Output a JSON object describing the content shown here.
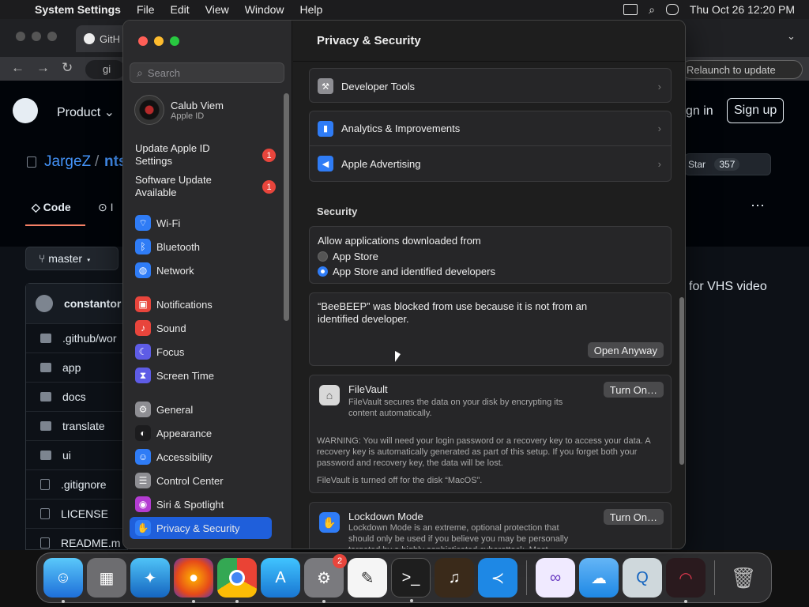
{
  "menubar": {
    "app": "System Settings",
    "items": [
      "File",
      "Edit",
      "View",
      "Window",
      "Help"
    ],
    "clock": "Thu Oct 26  12:20 PM"
  },
  "browser": {
    "tab_title": "GitH",
    "relaunch": "Relaunch to update",
    "url_partial": "gi",
    "gh_product": "Product",
    "gh_signin": "gn in",
    "gh_signup": "Sign up",
    "repo_owner": "JargeZ",
    "repo_sep": "/",
    "repo_name": "nts",
    "star_label": "Star",
    "star_count": "357",
    "tab_code": "Code",
    "tab_issues": "I",
    "branch": "master",
    "committer": "constantor",
    "desc_partial": "for VHS video",
    "files": [
      ".github/wor",
      "app",
      "docs",
      "translate",
      "ui",
      ".gitignore",
      "LICENSE",
      "README.m"
    ]
  },
  "settings": {
    "search_placeholder": "Search",
    "account": {
      "name": "Calub Viem",
      "sub": "Apple ID"
    },
    "updates": [
      {
        "label": "Update Apple ID Settings",
        "badge": "1"
      },
      {
        "label": "Software Update Available",
        "badge": "1"
      }
    ],
    "nav": [
      {
        "label": "Wi-Fi",
        "color": "#2f7cf6",
        "glyph": "⌔"
      },
      {
        "label": "Bluetooth",
        "color": "#2f7cf6",
        "glyph": "ᛒ"
      },
      {
        "label": "Network",
        "color": "#2f7cf6",
        "glyph": "◍"
      },
      {
        "label": "Notifications",
        "color": "#e8453c",
        "glyph": "▣"
      },
      {
        "label": "Sound",
        "color": "#e8453c",
        "glyph": "♪"
      },
      {
        "label": "Focus",
        "color": "#5e5ce6",
        "glyph": "☾"
      },
      {
        "label": "Screen Time",
        "color": "#5e5ce6",
        "glyph": "⧗"
      },
      {
        "label": "General",
        "color": "#8e8e93",
        "glyph": "⚙"
      },
      {
        "label": "Appearance",
        "color": "#1c1c1e",
        "glyph": "◐"
      },
      {
        "label": "Accessibility",
        "color": "#2f7cf6",
        "glyph": "☺"
      },
      {
        "label": "Control Center",
        "color": "#8e8e93",
        "glyph": "☰"
      },
      {
        "label": "Siri & Spotlight",
        "color": "#b43cd2",
        "glyph": "◉"
      },
      {
        "label": "Privacy & Security",
        "color": "#2f7cf6",
        "glyph": "✋"
      }
    ],
    "content_title": "Privacy & Security",
    "rows_top": [
      {
        "label": "Developer Tools"
      },
      {
        "label": "Analytics & Improvements"
      },
      {
        "label": "Apple Advertising"
      }
    ],
    "security_title": "Security",
    "allow_label": "Allow applications downloaded from",
    "opt_appstore": "App Store",
    "opt_identified": "App Store and identified developers",
    "blocked_msg": "“BeeBEEP” was blocked from use because it is not from an identified developer.",
    "open_anyway": "Open Anyway",
    "filevault": {
      "title": "FileVault",
      "desc": "FileVault secures the data on your disk by encrypting its content automatically.",
      "button": "Turn On…",
      "warning": "WARNING: You will need your login password or a recovery key to access your data. A recovery key is automatically generated as part of this setup. If you forget both your password and recovery key, the data will be lost.",
      "status": "FileVault is turned off for the disk “MacOS”."
    },
    "lockdown": {
      "title": "Lockdown Mode",
      "desc": "Lockdown Mode is an extreme, optional protection that should only be used if you believe you may be personally targeted by a highly sophisticated cyberattack. Most",
      "button": "Turn On…"
    }
  },
  "dock": {
    "settings_badge": "2"
  }
}
